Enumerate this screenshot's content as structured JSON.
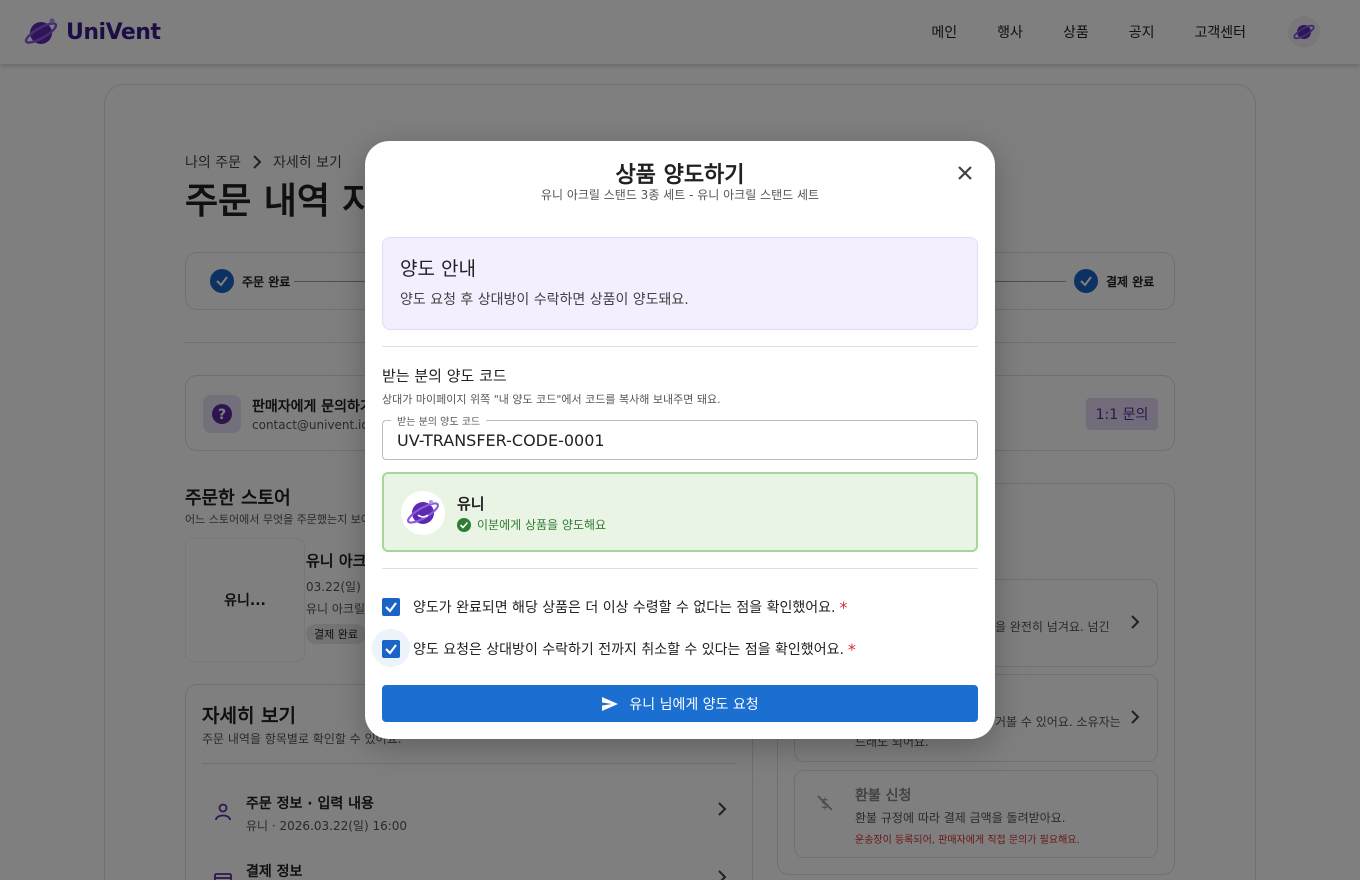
{
  "header": {
    "logo_text": "UniVent",
    "nav": [
      "메인",
      "행사",
      "상품",
      "공지",
      "고객센터"
    ]
  },
  "background": {
    "breadcrumb": [
      "나의 주문",
      "자세히 보기"
    ],
    "page_title": "주문 내역 자세히 보기",
    "steps": [
      "주문 완료",
      "결제 완료"
    ],
    "inquiry": {
      "title": "판매자에게 문의하기",
      "email": "contact@univent.io",
      "button": "1:1 문의"
    },
    "store": {
      "title": "주문한 스토어",
      "subtitle": "어느 스토어에서 무엇을 주문했는지 보여드려요.",
      "thumb": "유니...",
      "name": "유니 아크릴 스탠드",
      "date": "03.22(일) 16:00",
      "item": "유니 아크릴 스탠드 세트",
      "badge": "결제 완료"
    },
    "detail": {
      "title": "자세히 보기",
      "subtitle": "주문 내역을 항목별로 확인할 수 있어요.",
      "rows": [
        {
          "title": "주문 정보 · 입력 내용",
          "sub": "유니 · 2026.03.22(일) 16:00"
        },
        {
          "title": "결제 정보",
          "sub": ""
        }
      ]
    },
    "actions": [
      {
        "title": "",
        "text": "을 완전히 넘겨요. 넘긴"
      },
      {
        "title": "",
        "text": "거볼 수 있어요. 소유자는",
        "text2": "드래도 되어요."
      },
      {
        "title": "환불 신청",
        "text": "환불 규정에 따라 결제 금액을 돌려받아요.",
        "warn": "운송장이 등록되어, 판매자에게 직접 문의가 필요해요."
      }
    ]
  },
  "modal": {
    "title": "상품 양도하기",
    "subtitle": "유니 아크릴 스탠드 3종 세트 - 유니 아크릴 스탠드 세트",
    "notice": {
      "title": "양도 안내",
      "text": "양도 요청 후 상대방이 수락하면 상품이 양도돼요."
    },
    "code": {
      "label": "받는 분의 양도 코드",
      "help": "상대가 마이페이지 위쪽 \"내 양도 코드\"에서 코드를 복사해 보내주면 돼요.",
      "field_legend": "받는 분의 양도 코드",
      "value": "UV-TRANSFER-CODE-0001"
    },
    "recipient": {
      "name": "유니",
      "status": "이분에게 상품을 양도해요"
    },
    "checks": [
      {
        "text": "양도가 완료되면 해당 상품은 더 이상 수령할 수 없다는 점을 확인했어요.",
        "required": "*",
        "checked": true
      },
      {
        "text": "양도 요청은 상대방이 수락하기 전까지 취소할 수 있다는 점을 확인했어요.",
        "required": "*",
        "checked": true
      }
    ],
    "submit_label": "유니 님에게 양도 요청"
  },
  "colors": {
    "primary": "#1a6fd1",
    "brand": "#3a1a8a",
    "success_bg": "#eaf4e4",
    "success_border": "#a8d59a",
    "notice_bg": "#f4efff"
  }
}
